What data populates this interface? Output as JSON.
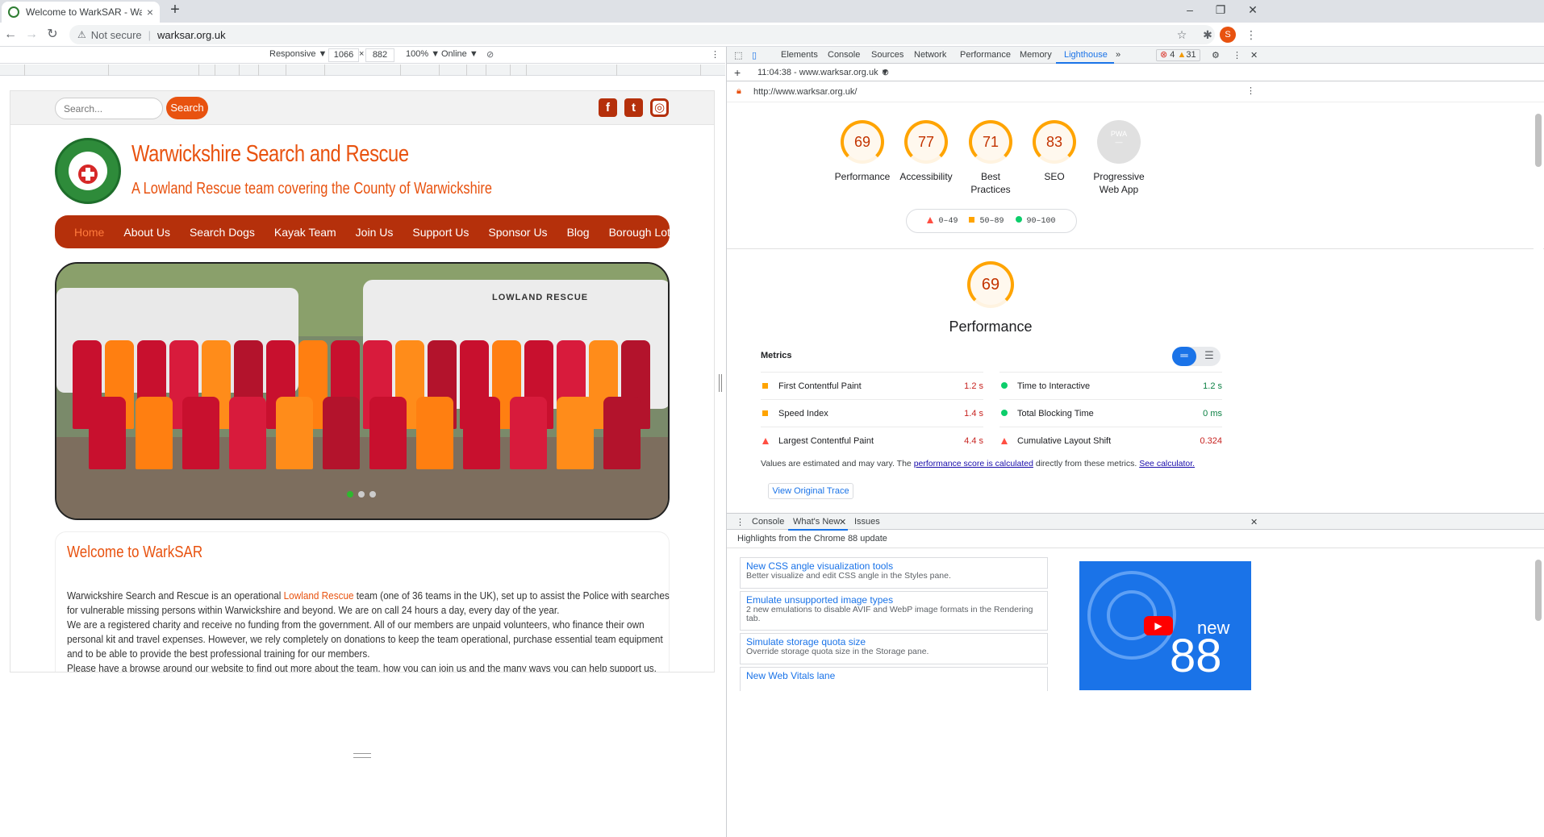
{
  "browser": {
    "tab_title": "Welcome to WarkSAR - Warwick",
    "tab_close": "×",
    "new_tab": "+",
    "not_secure": "Not secure",
    "url": "warksar.org.uk",
    "profile_initial": "S",
    "window_minimize": "–",
    "window_restore": "❐",
    "window_close": "✕"
  },
  "device_toolbar": {
    "mode": "Responsive ▼",
    "width": "1066",
    "times": "×",
    "height": "882",
    "zoom": "100% ▼",
    "network": "Online ▼"
  },
  "site": {
    "search_placeholder": "Search...",
    "search_button": "Search",
    "title": "Warwickshire Search and Rescue",
    "subtitle": "A Lowland Rescue team covering the County of Warwickshire",
    "nav": [
      "Home",
      "About Us",
      "Search Dogs",
      "Kayak Team",
      "Join Us",
      "Support Us",
      "Sponsor Us",
      "Blog",
      "Borough Lottery"
    ],
    "hero_van_text": "LOWLAND RESCUE",
    "welcome_title": "Welcome to WarkSAR",
    "welcome_p1_a": "Warwickshire Search and Rescue is an operational ",
    "welcome_p1_link": "Lowland Rescue",
    "welcome_p1_b": " team (one of 36 teams in the UK), set up to assist the Police with searches",
    "welcome_p2": "for vulnerable missing persons within Warwickshire and beyond. We are on call 24 hours a day, every day of the year.",
    "welcome_p3": "We are a registered charity and receive no funding from the government.  All of our members are unpaid volunteers, who finance their own",
    "welcome_p4": "personal kit and travel expenses.  However, we rely completely on donations to keep the team operational, purchase essential team equipment",
    "welcome_p5": "and to be able to provide the best professional training for our members.",
    "welcome_p6": "Please have a browse around our website to find out more about the team, how you can join us and the many ways you can help support us."
  },
  "devtools": {
    "tabs": [
      "Elements",
      "Console",
      "Sources",
      "Network",
      "Performance",
      "Memory",
      "Lighthouse"
    ],
    "more": "»",
    "errors": "4",
    "warnings": "31",
    "report_time": "11:04:38 - www.warksar.org.uk ▼",
    "report_url": "http://www.warksar.org.uk/",
    "scores": [
      {
        "value": "69",
        "label": "Performance"
      },
      {
        "value": "77",
        "label": "Accessibility"
      },
      {
        "value": "71",
        "label": "Best Practices"
      },
      {
        "value": "83",
        "label": "SEO"
      }
    ],
    "pwa_badge": "PWA",
    "pwa_label": "Progressive Web App",
    "legend": [
      "0–49",
      "50–89",
      "90–100"
    ],
    "perf_score": "69",
    "perf_title": "Performance",
    "metrics_header": "Metrics",
    "metrics": [
      {
        "name": "First Contentful Paint",
        "value": "1.2 s",
        "status": "average"
      },
      {
        "name": "Time to Interactive",
        "value": "1.2 s",
        "status": "pass"
      },
      {
        "name": "Speed Index",
        "value": "1.4 s",
        "status": "average"
      },
      {
        "name": "Total Blocking Time",
        "value": "0 ms",
        "status": "pass"
      },
      {
        "name": "Largest Contentful Paint",
        "value": "4.4 s",
        "status": "fail"
      },
      {
        "name": "Cumulative Layout Shift",
        "value": "0.324",
        "status": "fail"
      }
    ],
    "note_a": "Values are estimated and may vary. The ",
    "note_link1": "performance score is calculated",
    "note_b": " directly from these metrics. ",
    "note_link2": "See calculator.",
    "view_trace": "View Original Trace",
    "drawer_tabs": [
      "Console",
      "What's New",
      "Issues"
    ],
    "drawer_subtitle": "Highlights from the Chrome 88 update",
    "whats_new": [
      {
        "title": "New CSS angle visualization tools",
        "desc": "Better visualize and edit CSS angle in the Styles pane."
      },
      {
        "title": "Emulate unsupported image types",
        "desc": "2 new emulations to disable AVIF and WebP image formats in the Rendering tab."
      },
      {
        "title": "Simulate storage quota size",
        "desc": "Override storage quota size in the Storage pane."
      },
      {
        "title": "New Web Vitals lane",
        "desc": ""
      }
    ],
    "promo_new": "new",
    "promo_num": "88",
    "colors": {
      "fail": "#ff4e42",
      "average": "#ffa400",
      "pass": "#0cce6b"
    }
  }
}
